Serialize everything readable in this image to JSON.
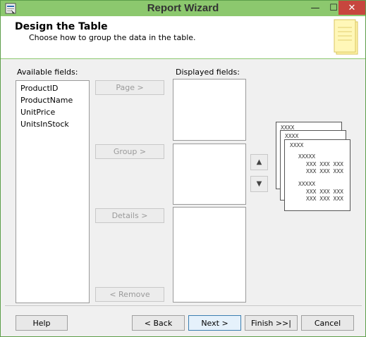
{
  "window": {
    "title": "Report Wizard",
    "controls": {
      "minimize": "—",
      "maximize": "☐",
      "close": "✕"
    }
  },
  "header": {
    "title": "Design the Table",
    "subtitle": "Choose how to group the data in the table."
  },
  "available": {
    "label": "Available fields:",
    "items": [
      "ProductID",
      "ProductName",
      "UnitPrice",
      "UnitsInStock"
    ]
  },
  "displayed": {
    "label": "Displayed fields:"
  },
  "move_buttons": {
    "page": "Page >",
    "group": "Group >",
    "details": "Details >",
    "remove": "< Remove"
  },
  "order_buttons": {
    "up": "▲",
    "down": "▼"
  },
  "preview": {
    "page_header": "XXXX",
    "group_header": "XXXXX",
    "detail_row": "XXX XXX XXX"
  },
  "footer": {
    "help": "Help",
    "back": "< Back",
    "next": "Next >",
    "finish": "Finish >>|",
    "cancel": "Cancel"
  }
}
